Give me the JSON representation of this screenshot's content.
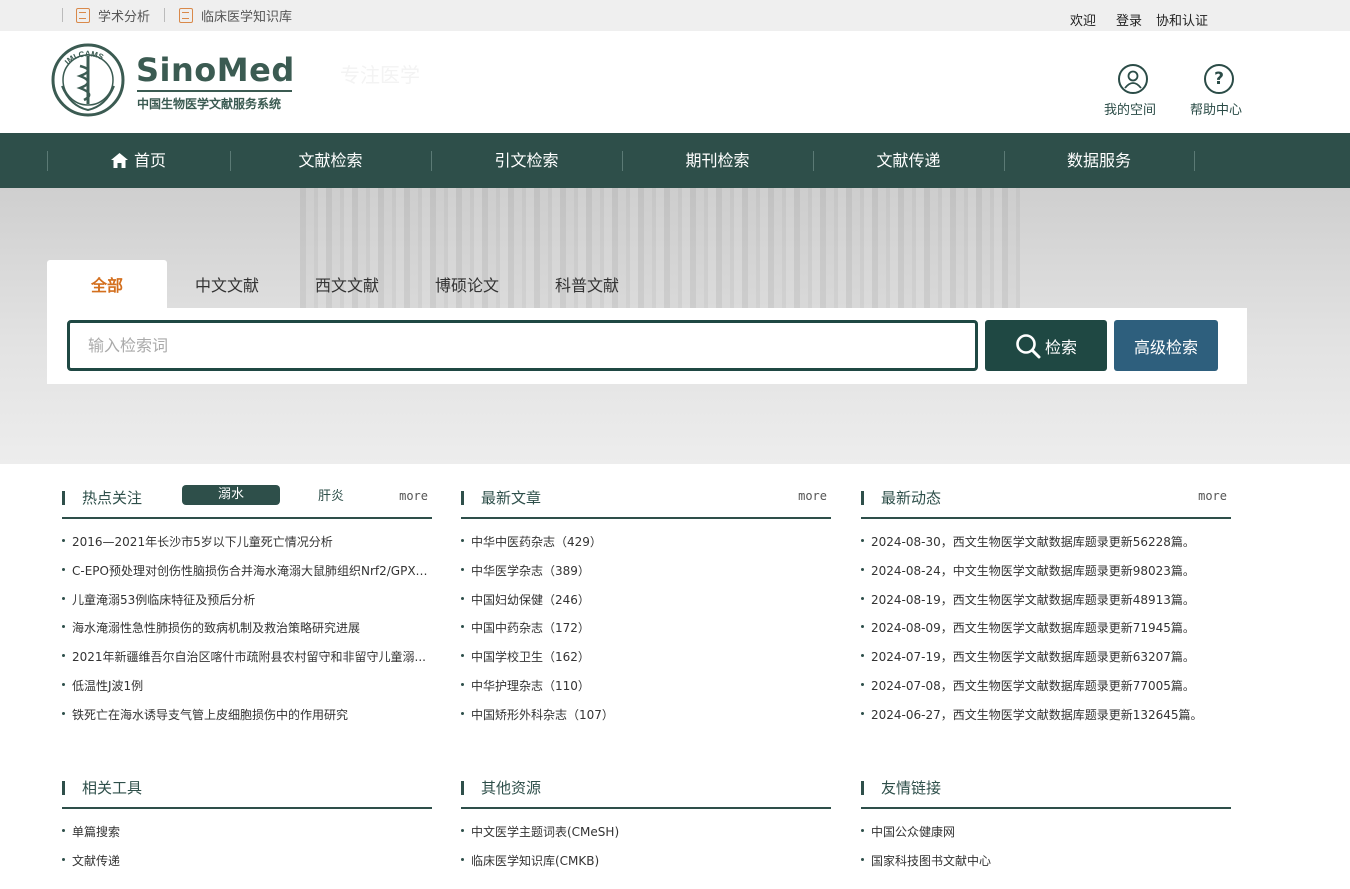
{
  "topbar": {
    "links": [
      "学术分析",
      "临床医学知识库"
    ],
    "right": [
      "欢迎",
      "登录",
      "协和认证"
    ]
  },
  "header": {
    "seal_text": "IMI.CAMS",
    "logo_name": "SinoMed",
    "logo_sub": "中国生物医学文献服务系统",
    "slogan": "专注医学",
    "my_space": "我的空间",
    "help_center": "帮助中心"
  },
  "nav": [
    "首页",
    "文献检索",
    "引文检索",
    "期刊检索",
    "文献传递",
    "数据服务"
  ],
  "search": {
    "tabs": [
      "全部",
      "中文文献",
      "西文文献",
      "博硕论文",
      "科普文献"
    ],
    "active_tab": 0,
    "placeholder": "输入检索词",
    "search_label": "检索",
    "advanced_label": "高级检索"
  },
  "hot": {
    "title": "热点关注",
    "pills": [
      "溺水",
      "肝炎"
    ],
    "more": "more",
    "items": [
      "2016—2021年长沙市5岁以下儿童死亡情况分析",
      "C-EPO预处理对创伤性脑损伤合并海水淹溺大鼠肺组织Nrf2/GPX4...",
      "儿童淹溺53例临床特征及预后分析",
      "海水淹溺性急性肺损伤的致病机制及救治策略研究进展",
      "2021年新疆维吾尔自治区喀什市疏附县农村留守和非留守儿童溺...",
      "低温性J波1例",
      "铁死亡在海水诱导支气管上皮细胞损伤中的作用研究"
    ]
  },
  "latest_articles": {
    "title": "最新文章",
    "more": "more",
    "items": [
      "中华中医药杂志（429）",
      "中华医学杂志（389）",
      "中国妇幼保健（246）",
      "中国中药杂志（172）",
      "中国学校卫生（162）",
      "中华护理杂志（110）",
      "中国矫形外科杂志（107）"
    ]
  },
  "latest_news": {
    "title": "最新动态",
    "more": "more",
    "items": [
      "2024-08-30，西文生物医学文献数据库题录更新56228篇。",
      "2024-08-24，中文生物医学文献数据库题录更新98023篇。",
      "2024-08-19，西文生物医学文献数据库题录更新48913篇。",
      "2024-08-09，西文生物医学文献数据库题录更新71945篇。",
      "2024-07-19，西文生物医学文献数据库题录更新63207篇。",
      "2024-07-08，西文生物医学文献数据库题录更新77005篇。",
      "2024-06-27，西文生物医学文献数据库题录更新132645篇。"
    ]
  },
  "tools": {
    "title": "相关工具",
    "items": [
      "单篇搜索",
      "文献传递"
    ]
  },
  "resources": {
    "title": "其他资源",
    "items": [
      "中文医学主题词表(CMeSH)",
      "临床医学知识库(CMKB)"
    ]
  },
  "friends": {
    "title": "友情链接",
    "items": [
      "中国公众健康网",
      "国家科技图书文献中心"
    ]
  }
}
